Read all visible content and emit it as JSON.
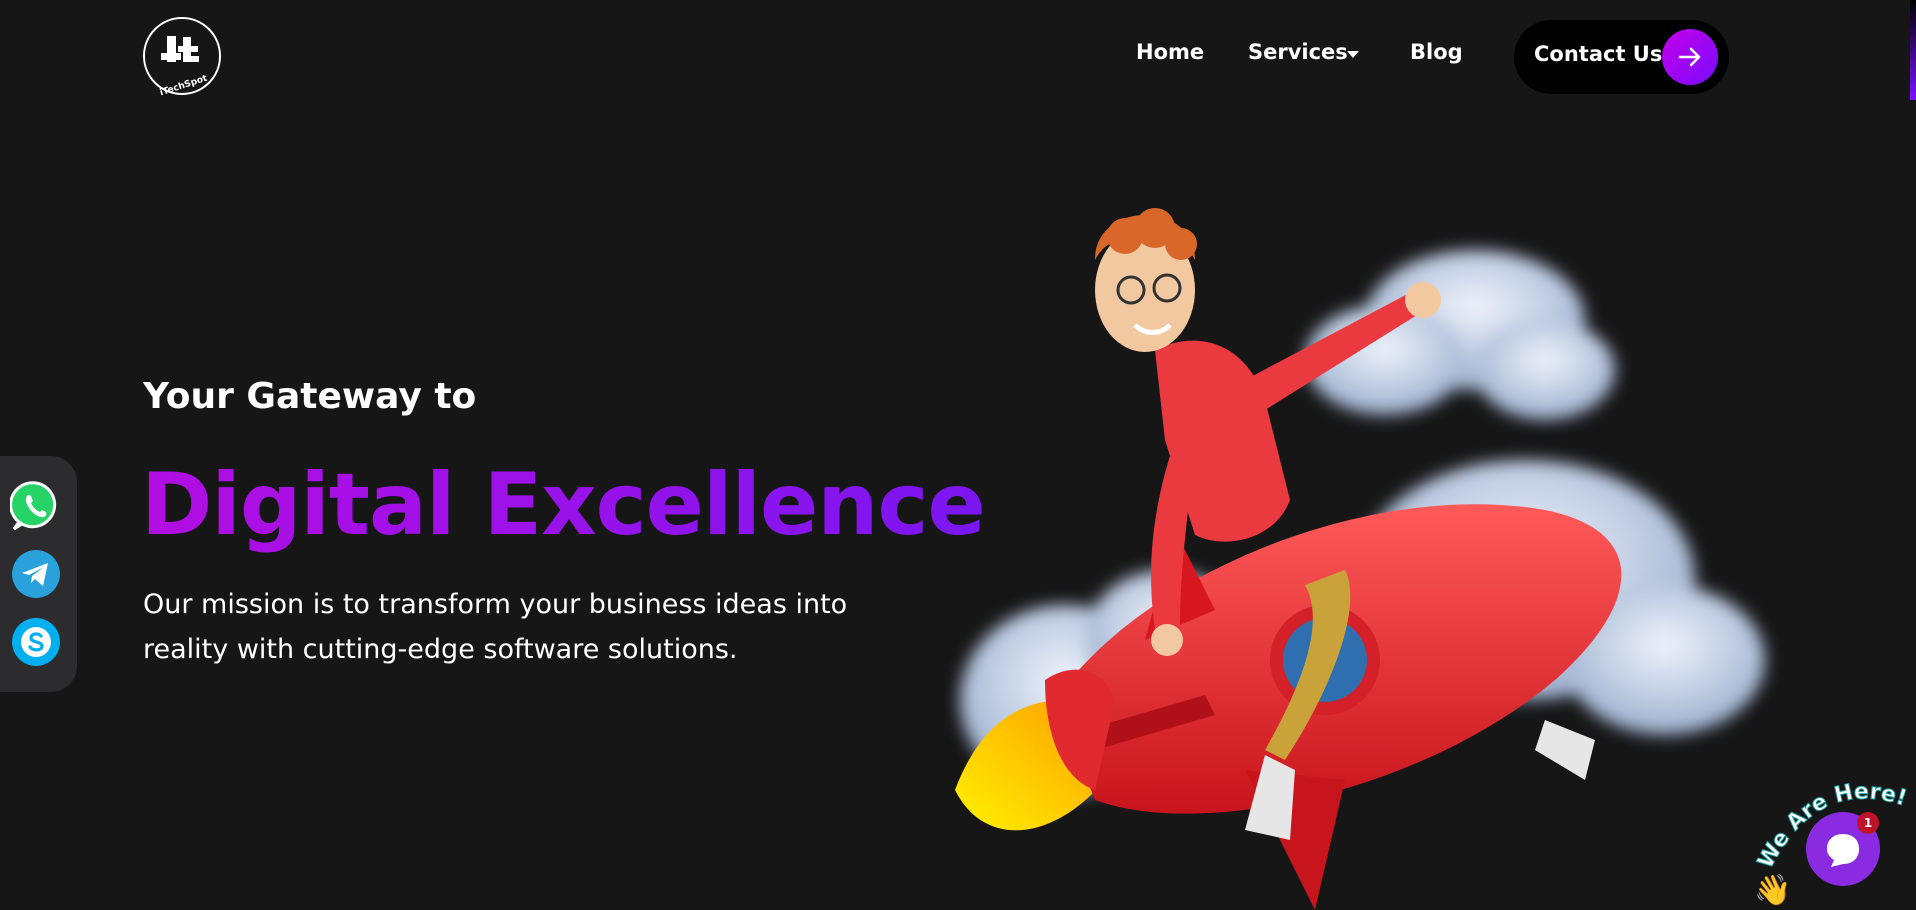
{
  "header": {
    "logo_text": "iTechSpot",
    "nav": [
      {
        "label": "Home"
      },
      {
        "label": "Services"
      },
      {
        "label": "Blog"
      }
    ],
    "contact_label": "Contact Us"
  },
  "hero": {
    "subtitle": "Your Gateway to",
    "title": "Digital Excellence",
    "description": "Our mission is to transform your business ideas into reality with cutting-edge software solutions."
  },
  "social": [
    {
      "name": "whatsapp",
      "color": "#25d366",
      "icon": "whatsapp-icon"
    },
    {
      "name": "telegram",
      "color": "#2aa1da",
      "icon": "telegram-icon"
    },
    {
      "name": "skype",
      "color": "#00aff0",
      "icon": "skype-icon"
    }
  ],
  "chat_widget": {
    "tagline": "We Are Here!",
    "badge_count": "1"
  },
  "colors": {
    "background": "#161617",
    "accent_start": "#b10ee2",
    "accent_end": "#7b16f0",
    "chat": "#8a2be2"
  }
}
